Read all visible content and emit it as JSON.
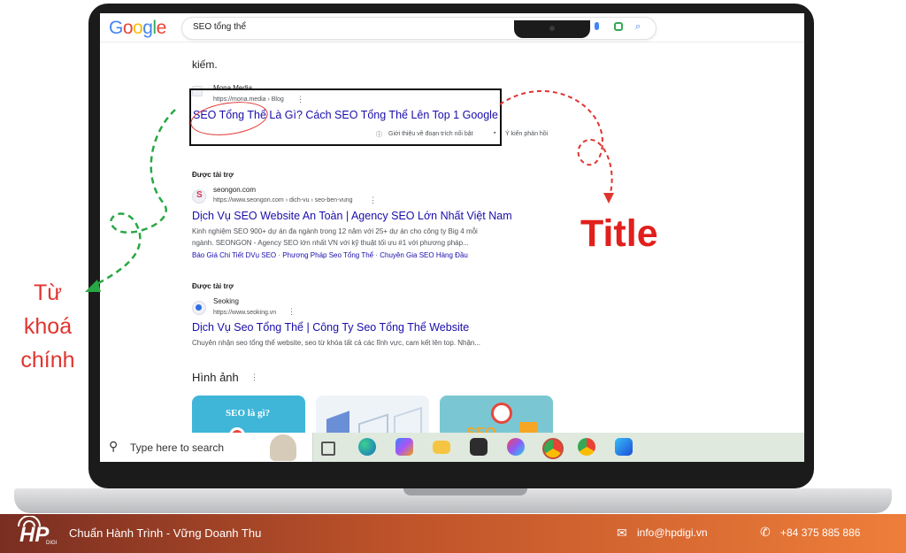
{
  "browser": {
    "logo": "Google",
    "search_query": "SEO tổng thể"
  },
  "results": {
    "leading_text": "kiếm.",
    "featured": {
      "site": "Mona Media",
      "url": "https://mona.media › Blog",
      "title": "SEO Tổng Thể Là Gì? Cách SEO Tổng Thể Lên Top 1 Google",
      "about_snippet": "Giới thiệu về đoạn trích nổi bật",
      "feedback": "Ý kiến phản hồi"
    },
    "ads": [
      {
        "label": "Được tài trợ",
        "site": "seongon.com",
        "url": "https://www.seongon.com › dich-vu › seo-ben-vung",
        "title": "Dịch Vụ SEO Website An Toàn | Agency SEO Lớn Nhất Việt Nam",
        "desc_line1": "Kinh nghiệm SEO 900+ dự án đa ngành trong 12 năm với 25+ dự án cho công ty Big 4 mỗi",
        "desc_line2": "ngành. SEONGON - Agency SEO lớn nhất VN với kỹ thuật tối ưu #1 với phương pháp...",
        "sitelinks": [
          "Báo Giá Chi Tiết DVụ SEO",
          "Phương Pháp Seo Tổng Thể",
          "Chuyên Gia SEO Hàng Đầu"
        ]
      },
      {
        "label": "Được tài trợ",
        "site": "Seoking",
        "url": "https://www.seoking.vn",
        "title": "Dịch Vụ Seo Tổng Thể | Công Ty Seo Tổng Thể Website",
        "desc_line1": "Chuyên nhận seo tổng thể website, seo từ khóa tất cả các lĩnh vực, cam kết lên top. Nhận..."
      }
    ],
    "images_heading": "Hình ảnh",
    "image_card_text": "SEO là gì?",
    "image_card_text_3": "SEO"
  },
  "taskbar": {
    "search_placeholder": "Type here to search"
  },
  "annotations": {
    "title_label": "Title",
    "keyword_label": "Từ khoá chính"
  },
  "footer": {
    "logo": "HP",
    "logo_sub": "DIGI",
    "slogan": "Chuẩn Hành Trình - Vững Doanh Thu",
    "email": "info@hpdigi.vn",
    "phone": "+84 375 885 886"
  },
  "colors": {
    "accent_red": "#e0342f",
    "link_blue": "#1a0dab",
    "footer_start": "#7a2e22",
    "footer_end": "#ee7e3a"
  }
}
